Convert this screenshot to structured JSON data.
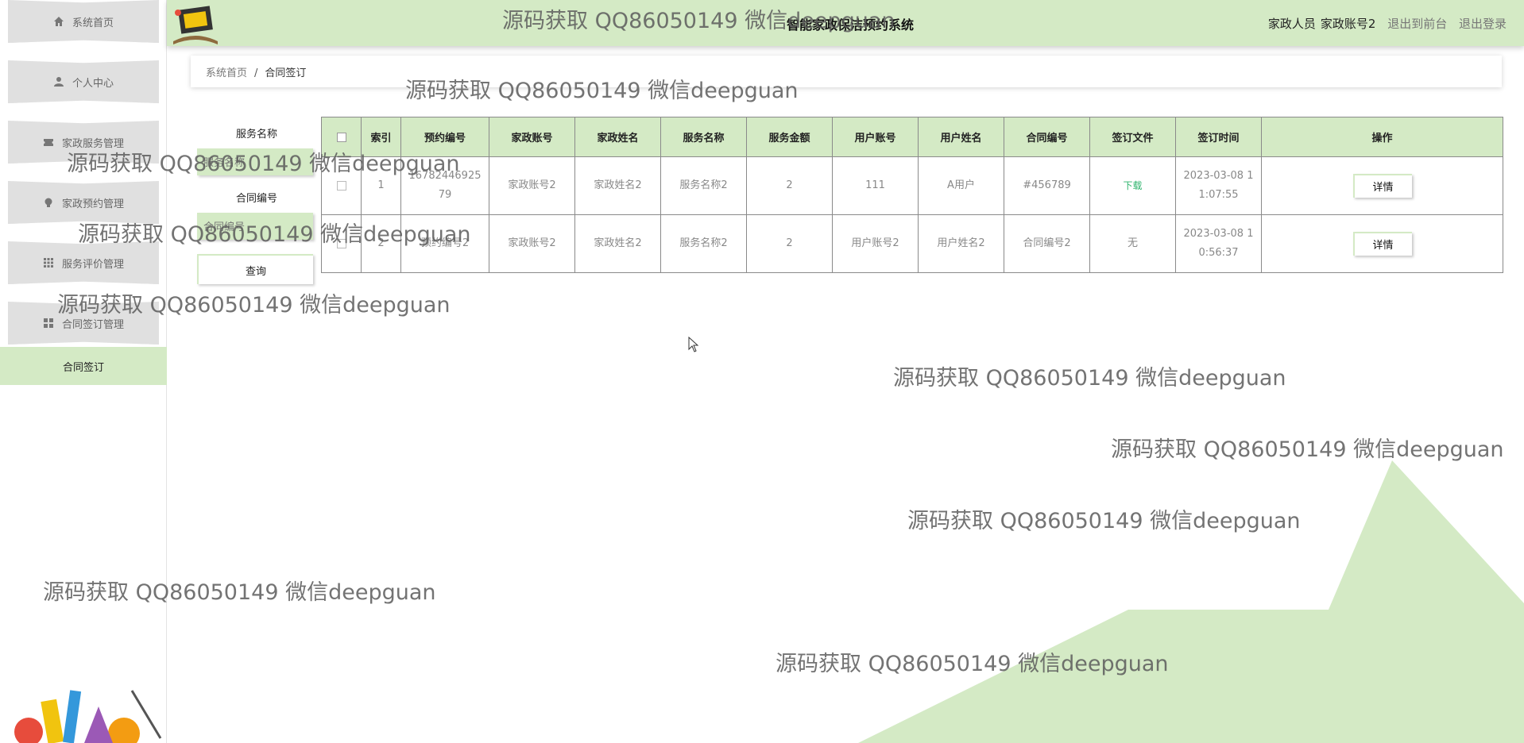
{
  "header": {
    "title": "智能家政保洁预约系统",
    "user_role": "家政人员",
    "username": "家政账号2",
    "back_to_front": "退出到前台",
    "logout": "退出登录"
  },
  "sidebar": {
    "items": [
      {
        "label": "系统首页",
        "icon": "home-icon"
      },
      {
        "label": "个人中心",
        "icon": "user-icon"
      },
      {
        "label": "家政服务管理",
        "icon": "ticket-icon"
      },
      {
        "label": "家政预约管理",
        "icon": "lightbulb-icon"
      },
      {
        "label": "服务评价管理",
        "icon": "grid-icon"
      },
      {
        "label": "合同签订管理",
        "icon": "apps-icon"
      }
    ],
    "submenu": {
      "label": "合同签订"
    }
  },
  "breadcrumb": {
    "home": "系统首页",
    "separator": "/",
    "current": "合同签订"
  },
  "search": {
    "service_name_label": "服务名称",
    "service_name_placeholder": "服务名称",
    "contract_no_label": "合同编号",
    "contract_no_placeholder": "合同编号",
    "query_button": "查询"
  },
  "table": {
    "columns": [
      "索引",
      "预约编号",
      "家政账号",
      "家政姓名",
      "服务名称",
      "服务金额",
      "用户账号",
      "用户姓名",
      "合同编号",
      "签订文件",
      "签订时间",
      "操作"
    ],
    "rows": [
      {
        "index": "1",
        "booking_no": "1678244692579",
        "staff_account": "家政账号2",
        "staff_name": "家政姓名2",
        "service_name": "服务名称2",
        "amount": "2",
        "user_account": "111",
        "user_name": "A用户",
        "contract_no": "#456789",
        "file": "下载",
        "time": "2023-03-08 11:07:55",
        "action": "详情"
      },
      {
        "index": "2",
        "booking_no": "预约编号2",
        "staff_account": "家政账号2",
        "staff_name": "家政姓名2",
        "service_name": "服务名称2",
        "amount": "2",
        "user_account": "用户账号2",
        "user_name": "用户姓名2",
        "contract_no": "合同编号2",
        "file": "无",
        "time": "2023-03-08 10:56:37",
        "action": "详情"
      }
    ]
  },
  "watermark": {
    "text": "源码获取 QQ86050149 微信deepguan"
  },
  "colors": {
    "accent": "#d4eac5",
    "download_link": "#2db36c"
  }
}
